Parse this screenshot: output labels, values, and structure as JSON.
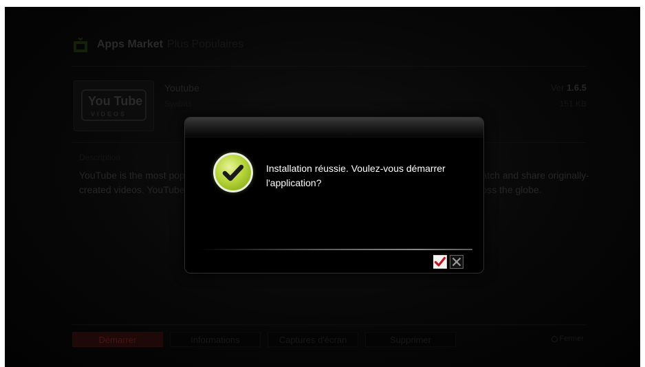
{
  "header": {
    "app_name": "Apps Market",
    "section": "Plus Populaires"
  },
  "app": {
    "name": "Youtube",
    "vendor": "Syabas",
    "version_label": "Ver",
    "version": "1.6.5",
    "size": "151 KB",
    "thumbnail_text": "You Tube",
    "thumbnail_subtext": "VIDEOS"
  },
  "description": {
    "label": "Description",
    "text": "YouTube is the most popular online video community, allowing millions of people to discover, watch and share originally-created videos. YouTube provides a forum for people to connect, inform, and inspire others across the globe."
  },
  "buttons": {
    "start": "Démarrer",
    "info": "Informations",
    "screenshots": "Captures d'écran",
    "delete": "Supprimer"
  },
  "close_hint": "Fermer",
  "dialog": {
    "message": "Installation réussie. Voulez-vous démarrer l'application?",
    "confirm_icon": "check-icon",
    "cancel_icon": "close-icon"
  },
  "colors": {
    "success": "#9cc02a",
    "confirm_check": "#c0141e",
    "dialog_text": "#ffffff"
  }
}
